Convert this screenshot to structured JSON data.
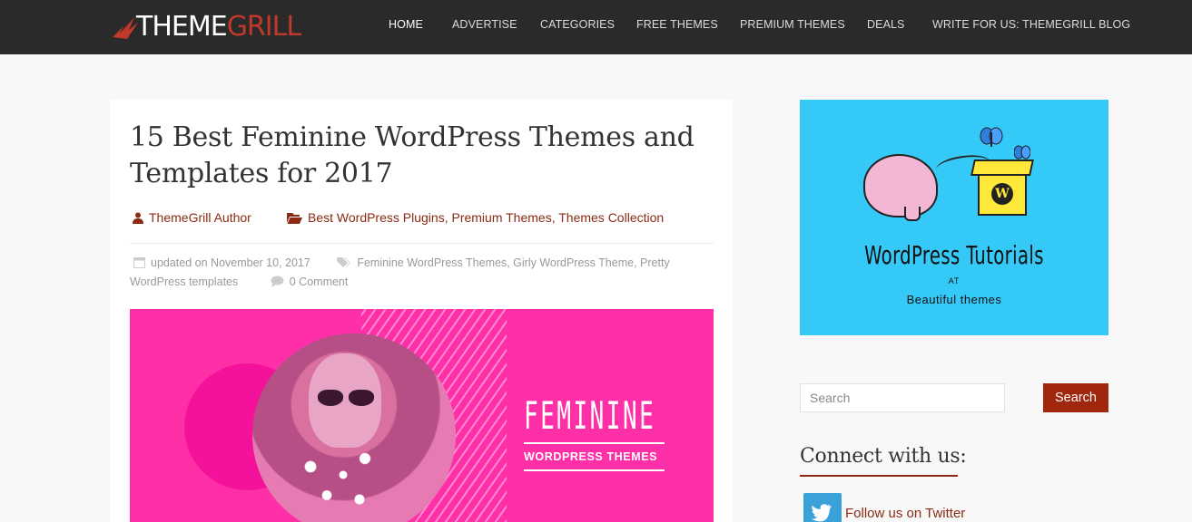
{
  "header": {
    "logo": {
      "part1": "THEME",
      "part2": "GRILL"
    },
    "nav": [
      {
        "label": "HOME",
        "active": true
      },
      {
        "label": "ADVERTISE",
        "active": false
      },
      {
        "label": "CATEGORIES",
        "active": false
      },
      {
        "label": "FREE THEMES",
        "active": false
      },
      {
        "label": "PREMIUM THEMES",
        "active": false
      },
      {
        "label": "DEALS",
        "active": false
      },
      {
        "label": "WRITE FOR US: THEMEGRILL BLOG",
        "active": false
      }
    ]
  },
  "article": {
    "title": "15 Best Feminine WordPress Themes and Templates for 2017",
    "author": "ThemeGrill Author",
    "categories": [
      "Best WordPress Plugins",
      "Premium Themes",
      "Themes Collection"
    ],
    "updated_prefix": "updated on",
    "updated_date": "November 10, 2017",
    "tags": [
      "Feminine WordPress Themes",
      "Girly WordPress Theme",
      "Pretty WordPress templates"
    ],
    "comments": "0 Comment",
    "featured_image": {
      "title": "FEMININE",
      "subtitle": "WORDPRESS THEMES",
      "background": "#ff2fa8"
    }
  },
  "sidebar": {
    "promo": {
      "title": "WordPress Tutorials",
      "at": "AT",
      "subtitle": "Beautiful themes",
      "background": "#35c9f7"
    },
    "search": {
      "placeholder": "Search",
      "button_label": "Search"
    },
    "connect": {
      "heading": "Connect with us:",
      "twitter_label": "Follow us on Twitter"
    }
  },
  "colors": {
    "header_bg": "#2a2a2a",
    "accent": "#a0260d",
    "link": "#8a2a14",
    "page_bg": "#f8f8f8"
  }
}
